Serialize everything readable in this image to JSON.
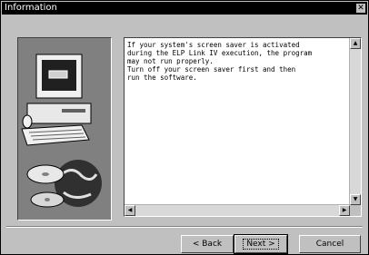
{
  "window": {
    "title": "Information",
    "close_glyph": "✕"
  },
  "message": "If your system's screen saver is activated\nduring the ELP Link IV execution, the program\nmay not run properly.\nTurn off your screen saver first and then\nrun the software.",
  "buttons": {
    "back": "< Back",
    "next": "Next >",
    "cancel": "Cancel"
  },
  "scroll_glyphs": {
    "up": "▲",
    "down": "▼",
    "left": "◀",
    "right": "▶"
  },
  "illustration": {
    "icon": "computer-with-cd-and-globe-icon"
  }
}
